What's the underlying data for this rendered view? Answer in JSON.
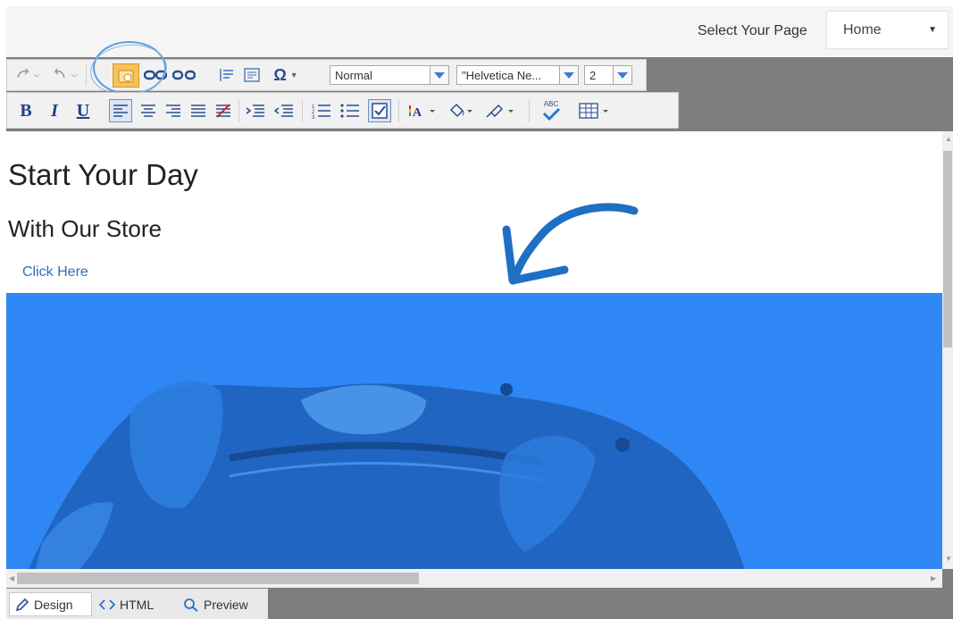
{
  "header": {
    "select_label": "Select Your Page",
    "select_value": "Home"
  },
  "toolbar": {
    "format_block": "Normal",
    "font_name": "\"Helvetica Ne...",
    "font_size": "2",
    "bold": "B",
    "italic": "I",
    "underline": "U",
    "symbol": "Ω",
    "spellcheck_label": "ABC"
  },
  "content": {
    "heading": "Start Your Day",
    "subheading": "With Our Store",
    "link_text": "Click Here"
  },
  "tabs": [
    {
      "label": "Design"
    },
    {
      "label": "HTML"
    },
    {
      "label": "Preview"
    }
  ],
  "colors": {
    "hero": "#2f87f5",
    "annotation": "#1f6fc5"
  }
}
